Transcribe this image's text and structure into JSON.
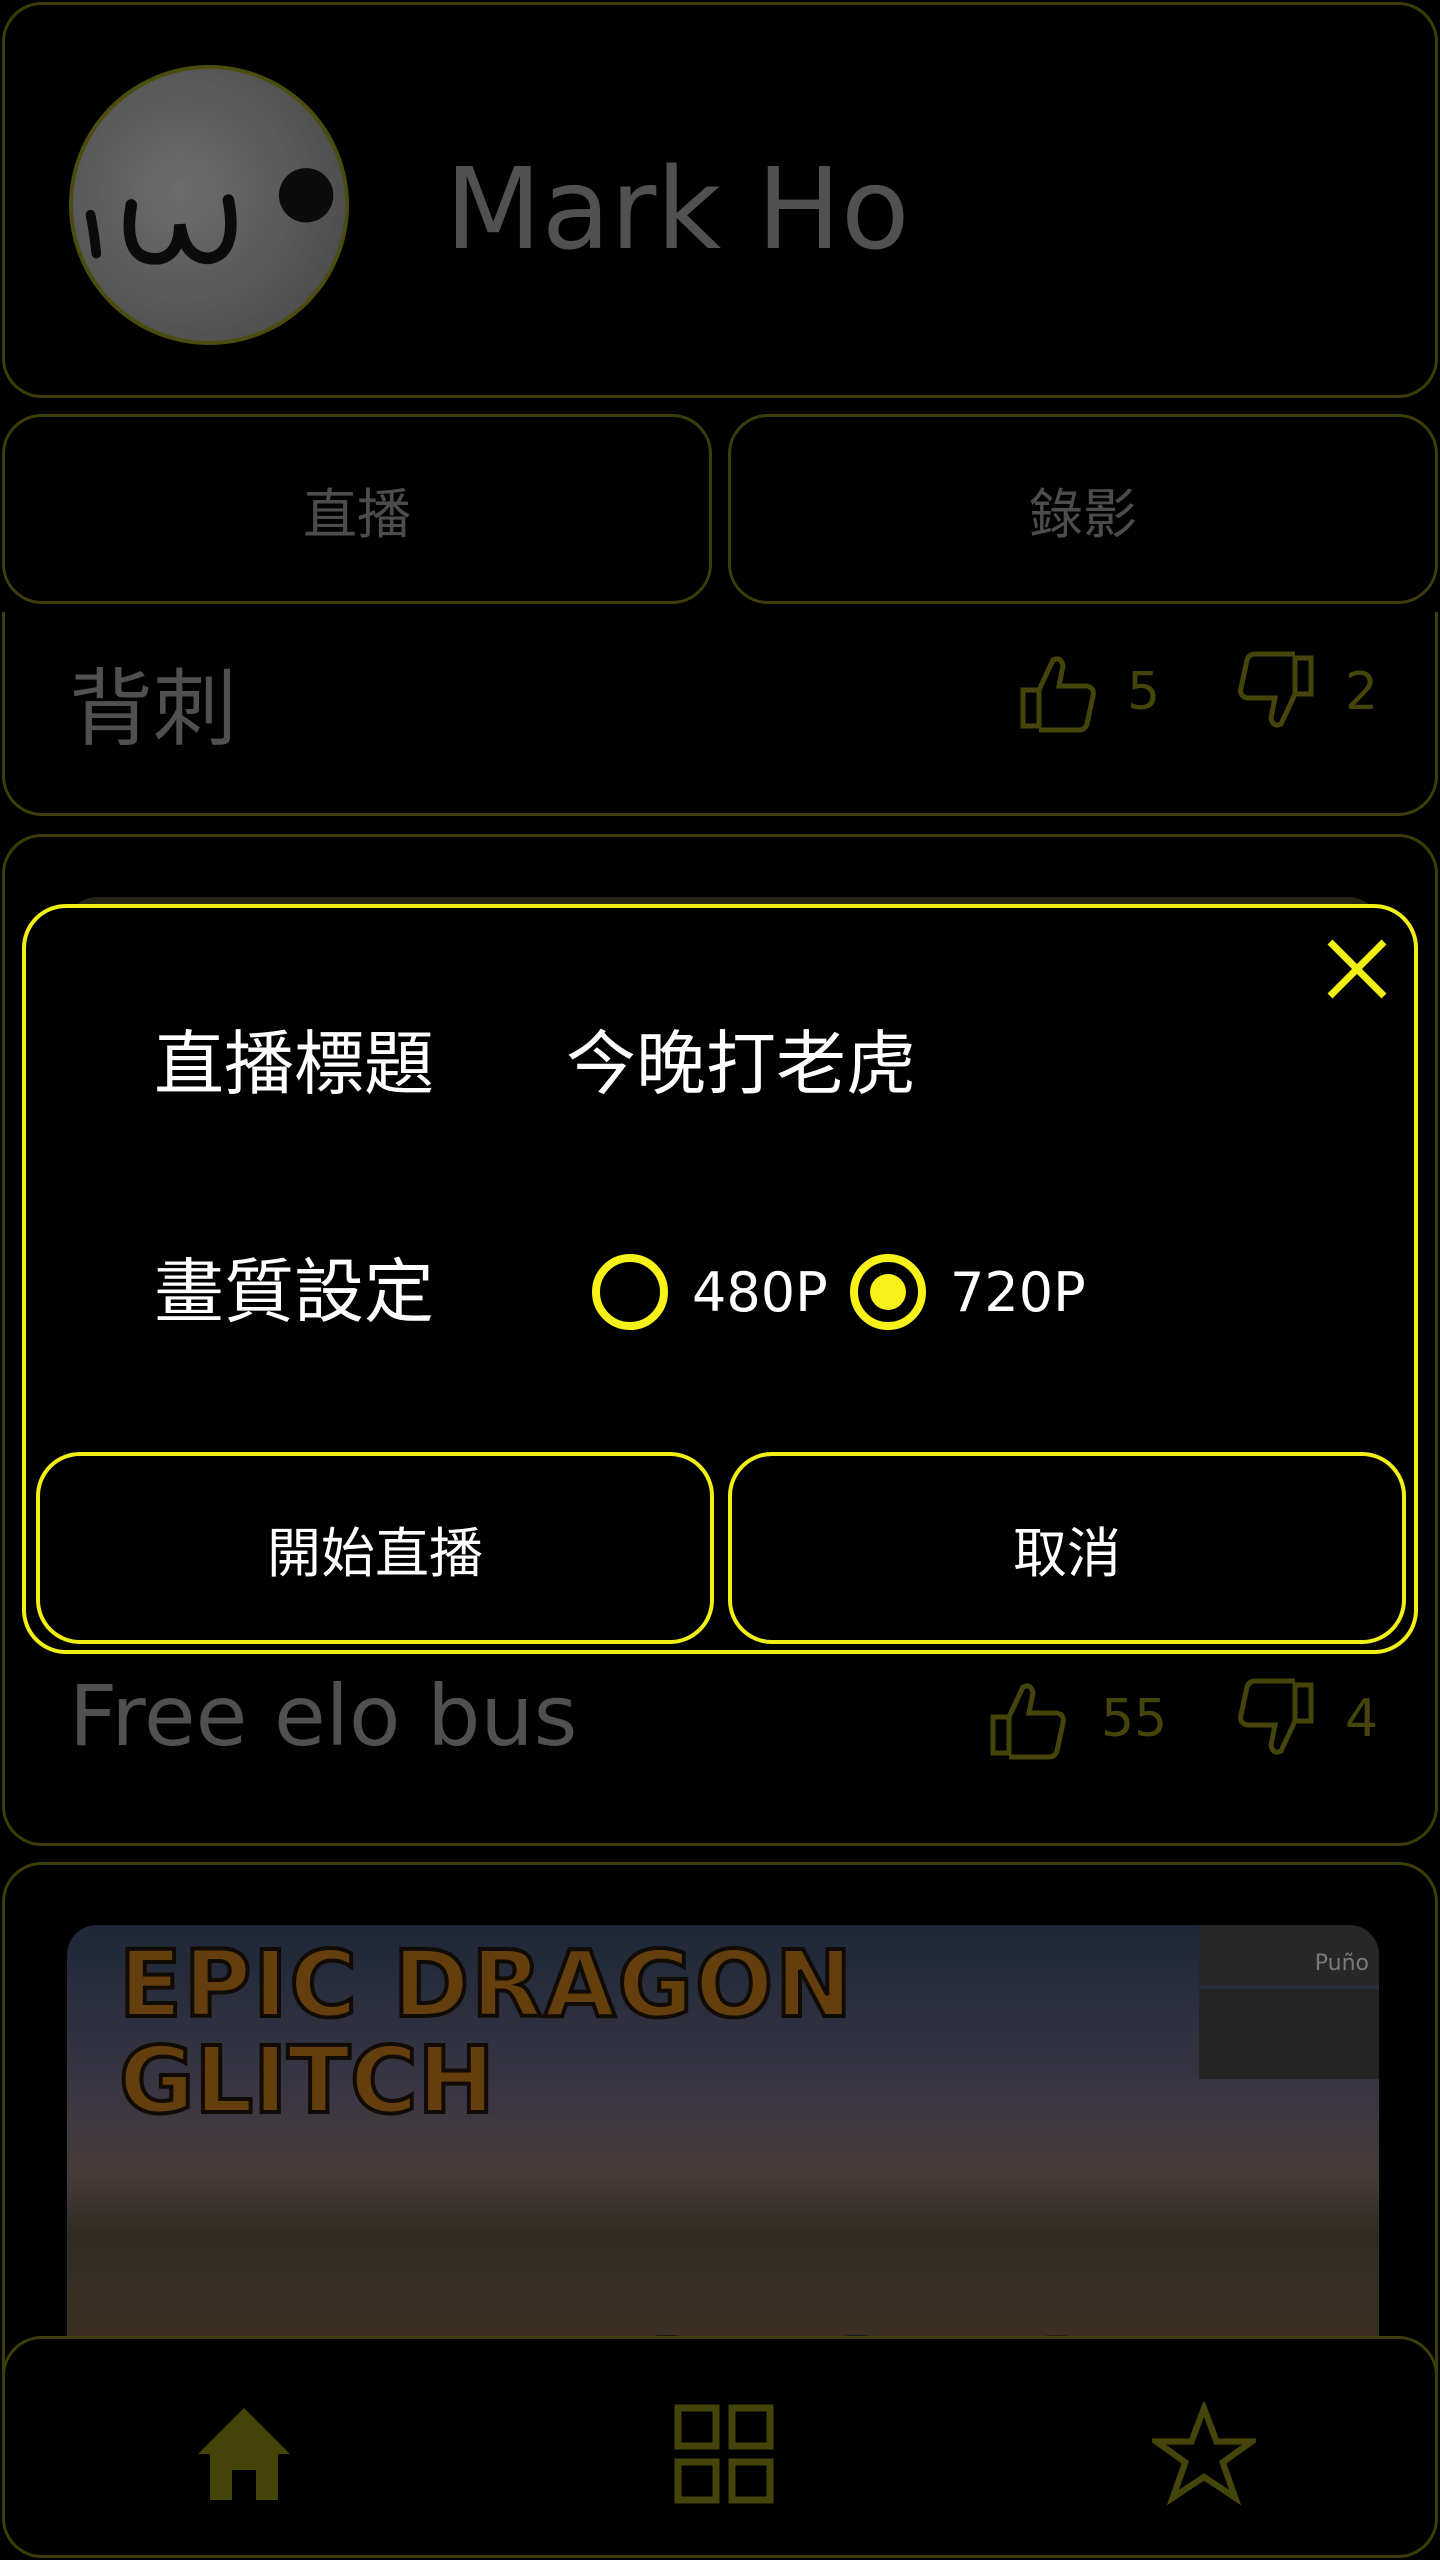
{
  "profile": {
    "name": "Mark Ho"
  },
  "tabs": {
    "live": "直播",
    "record": "錄影"
  },
  "cards": [
    {
      "title": "背刺",
      "likes": "5",
      "dislikes": "2"
    },
    {
      "title": "Free elo bus",
      "likes": "55",
      "dislikes": "4"
    },
    {
      "thumb_text_1": "EPIC DRAGON",
      "thumb_text_2": "GLITCH",
      "hud_text": "Puño"
    }
  ],
  "dialog": {
    "title_label": "直播標題",
    "title_value": "今晚打老虎",
    "quality_label": "畫質設定",
    "option_480": "480P",
    "option_720": "720P",
    "selected": "720P",
    "start_button": "開始直播",
    "cancel_button": "取消"
  },
  "nav": {
    "items": [
      "home-icon",
      "grid-icon",
      "star-icon"
    ]
  },
  "colors": {
    "accent": "#f2ef14",
    "dim_accent": "#6b6a12",
    "background": "#000000"
  }
}
